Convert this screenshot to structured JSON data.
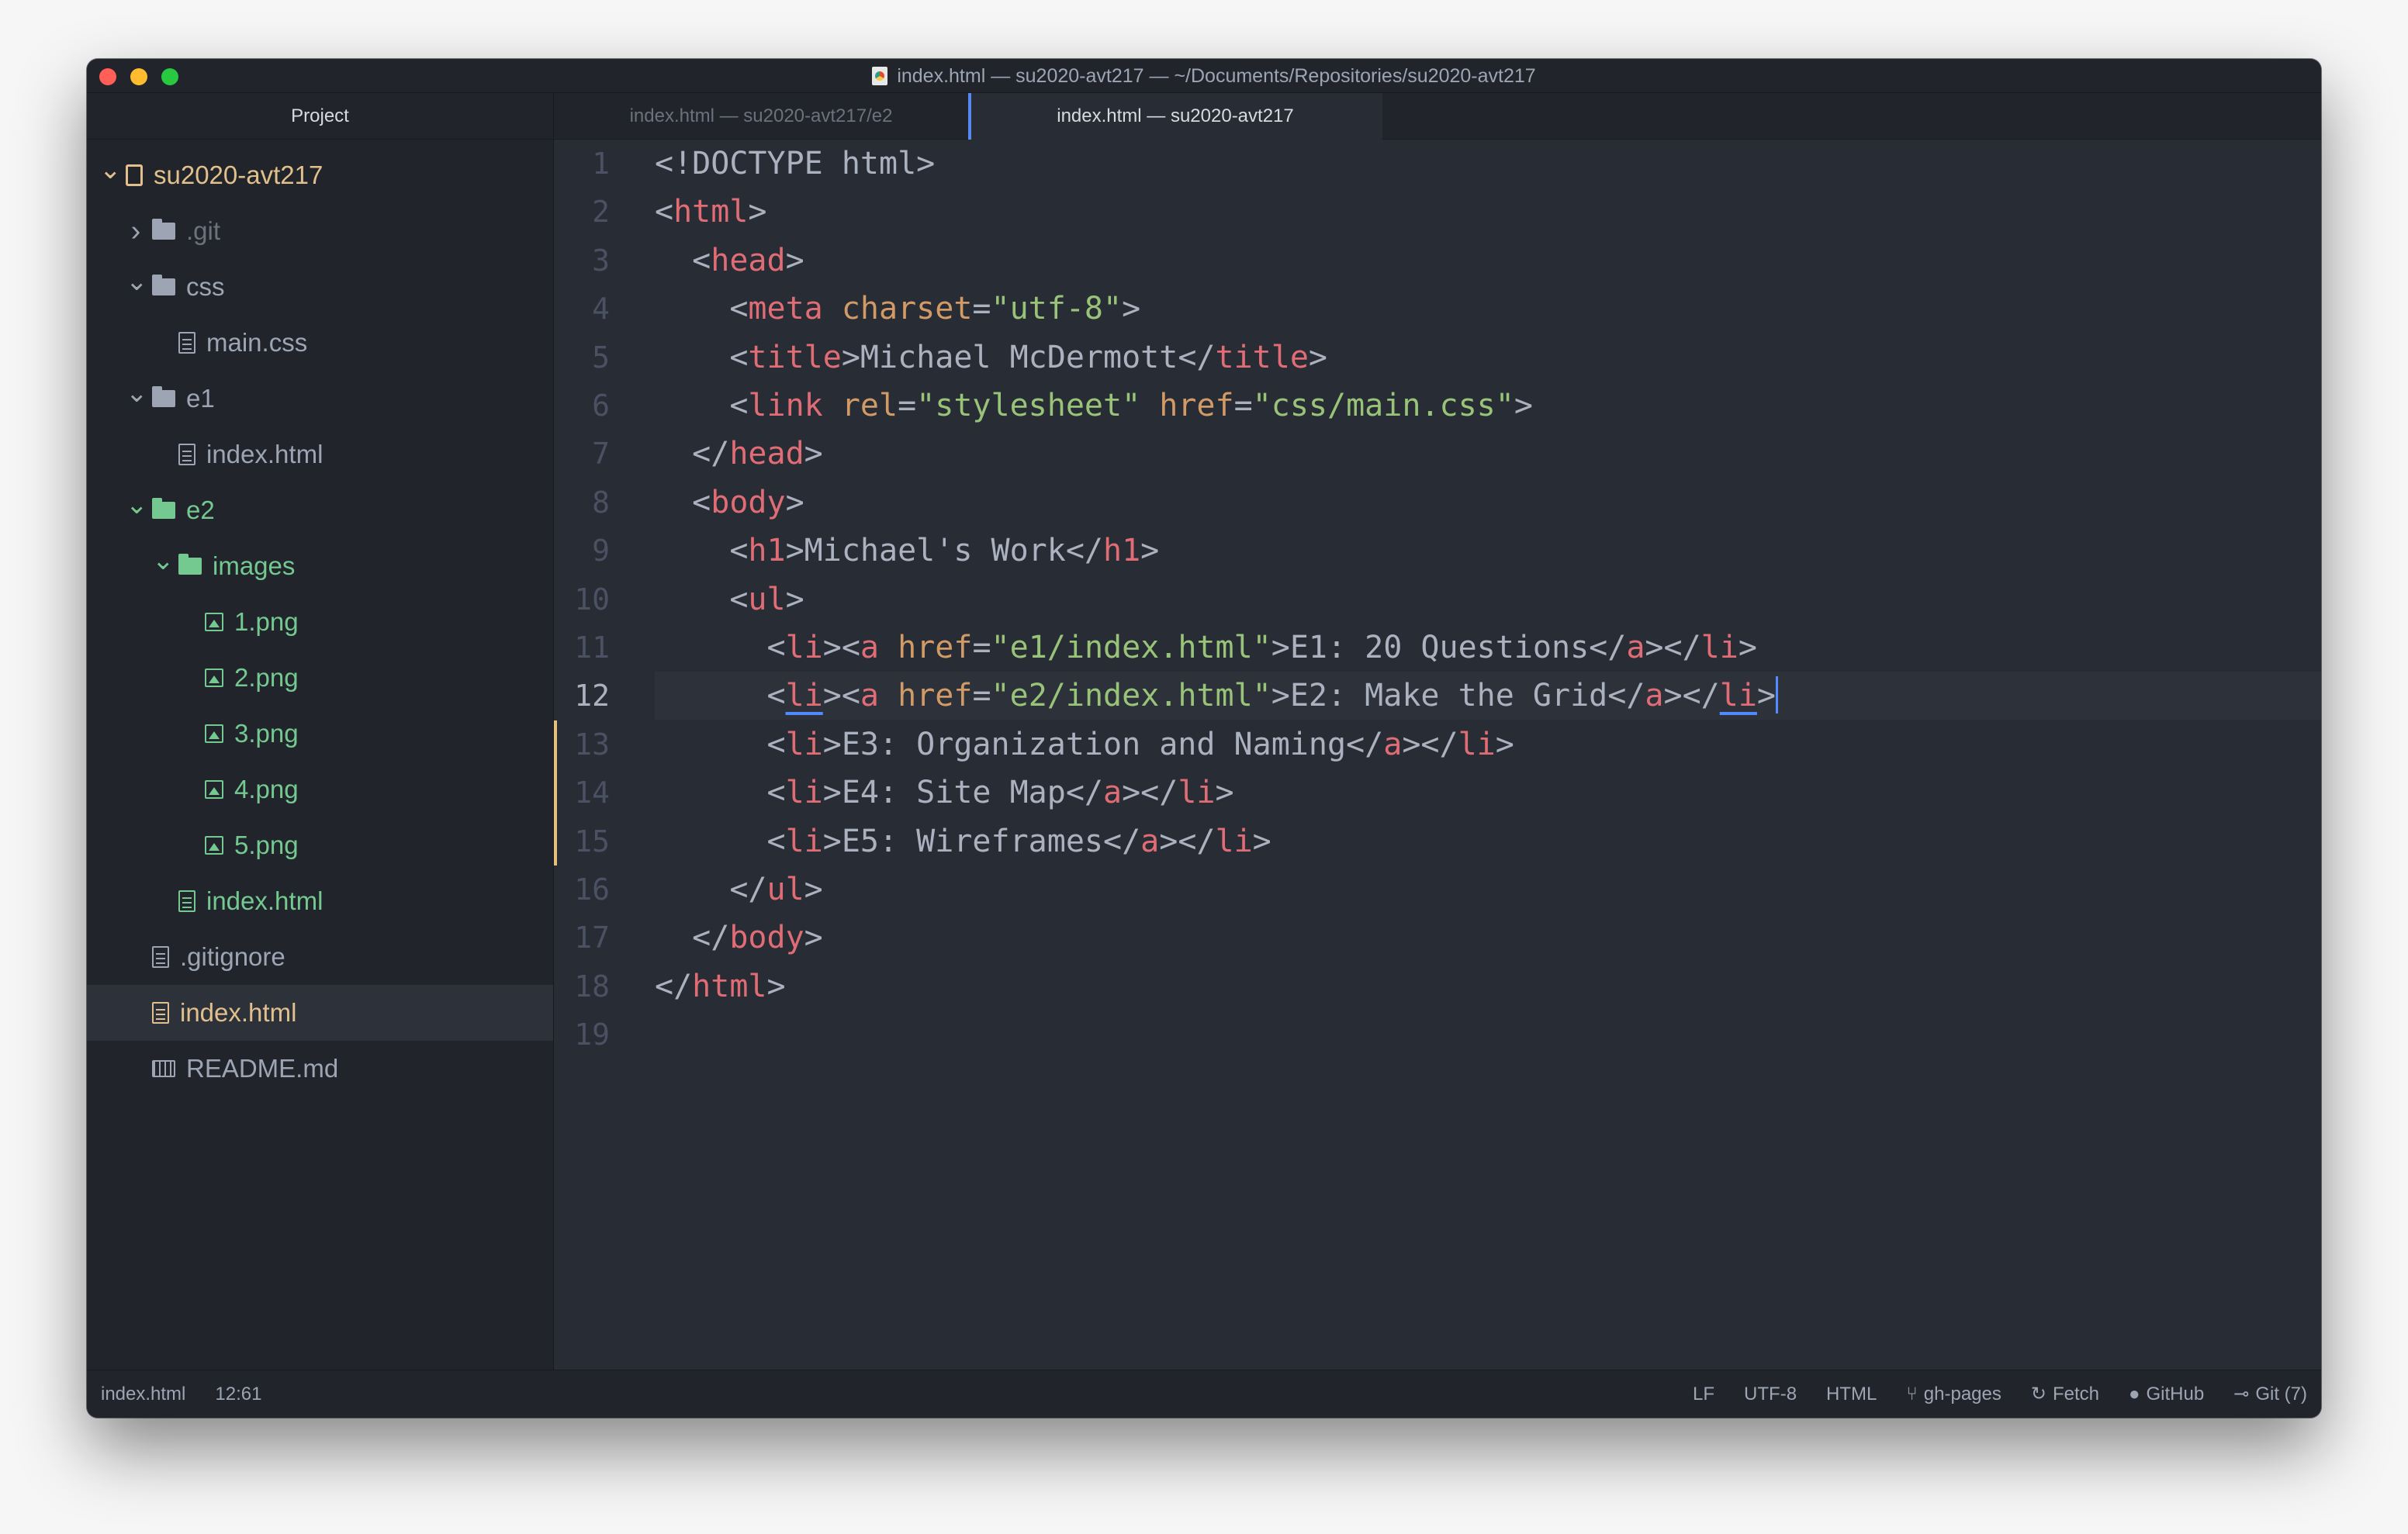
{
  "window": {
    "title": "index.html — su2020-avt217 — ~/Documents/Repositories/su2020-avt217"
  },
  "sidebar": {
    "header": "Project",
    "tree": [
      {
        "name": "root",
        "label": "su2020-avt217",
        "level": 0,
        "chevron": "down",
        "icon": "repo-icon",
        "color": "gold"
      },
      {
        "name": "git-folder",
        "label": ".git",
        "level": 1,
        "chevron": "right",
        "icon": "folder-icon",
        "color": "muted"
      },
      {
        "name": "css-folder",
        "label": "css",
        "level": 1,
        "chevron": "down",
        "icon": "folder-icon",
        "color": "normal"
      },
      {
        "name": "main-css",
        "label": "main.css",
        "level": 2,
        "chevron": "none",
        "icon": "file-icon",
        "color": "normal"
      },
      {
        "name": "e1-folder",
        "label": "e1",
        "level": 1,
        "chevron": "down",
        "icon": "folder-icon",
        "color": "normal"
      },
      {
        "name": "e1-index",
        "label": "index.html",
        "level": 2,
        "chevron": "none",
        "icon": "file-icon",
        "color": "normal"
      },
      {
        "name": "e2-folder",
        "label": "e2",
        "level": 1,
        "chevron": "down",
        "icon": "folder-icon",
        "color": "green"
      },
      {
        "name": "images-folder",
        "label": "images",
        "level": 2,
        "chevron": "down",
        "icon": "folder-icon",
        "color": "green"
      },
      {
        "name": "img-1",
        "label": "1.png",
        "level": 3,
        "chevron": "none",
        "icon": "image-icon",
        "color": "green"
      },
      {
        "name": "img-2",
        "label": "2.png",
        "level": 3,
        "chevron": "none",
        "icon": "image-icon",
        "color": "green"
      },
      {
        "name": "img-3",
        "label": "3.png",
        "level": 3,
        "chevron": "none",
        "icon": "image-icon",
        "color": "green"
      },
      {
        "name": "img-4",
        "label": "4.png",
        "level": 3,
        "chevron": "none",
        "icon": "image-icon",
        "color": "green"
      },
      {
        "name": "img-5",
        "label": "5.png",
        "level": 3,
        "chevron": "none",
        "icon": "image-icon",
        "color": "green"
      },
      {
        "name": "e2-index",
        "label": "index.html",
        "level": 2,
        "chevron": "none",
        "icon": "file-icon",
        "color": "green"
      },
      {
        "name": "gitignore",
        "label": ".gitignore",
        "level": 1,
        "chevron": "none",
        "icon": "file-icon",
        "color": "normal"
      },
      {
        "name": "root-index",
        "label": "index.html",
        "level": 1,
        "chevron": "none",
        "icon": "file-icon",
        "color": "gold",
        "selected": true
      },
      {
        "name": "readme",
        "label": "README.md",
        "level": 1,
        "chevron": "none",
        "icon": "book-icon",
        "color": "normal"
      }
    ]
  },
  "tabs": [
    {
      "label": "index.html — su2020-avt217/e2",
      "active": false
    },
    {
      "label": "index.html — su2020-avt217",
      "active": true
    }
  ],
  "editor": {
    "current_line": 12,
    "modified_lines": [
      13,
      14,
      15
    ],
    "lines": [
      [
        [
          "p",
          "<!DOCTYPE html>"
        ]
      ],
      [
        [
          "p",
          "<"
        ],
        [
          "t",
          "html"
        ],
        [
          "p",
          ">"
        ]
      ],
      [
        [
          "p",
          "  <"
        ],
        [
          "t",
          "head"
        ],
        [
          "p",
          ">"
        ]
      ],
      [
        [
          "p",
          "    <"
        ],
        [
          "t",
          "meta"
        ],
        [
          "p",
          " "
        ],
        [
          "a",
          "charset"
        ],
        [
          "p",
          "="
        ],
        [
          "s",
          "\"utf-8\""
        ],
        [
          "p",
          ">"
        ]
      ],
      [
        [
          "p",
          "    <"
        ],
        [
          "t",
          "title"
        ],
        [
          "p",
          ">Michael McDermott</"
        ],
        [
          "t",
          "title"
        ],
        [
          "p",
          ">"
        ]
      ],
      [
        [
          "p",
          "    <"
        ],
        [
          "t",
          "link"
        ],
        [
          "p",
          " "
        ],
        [
          "a",
          "rel"
        ],
        [
          "p",
          "="
        ],
        [
          "s",
          "\"stylesheet\""
        ],
        [
          "p",
          " "
        ],
        [
          "a",
          "href"
        ],
        [
          "p",
          "="
        ],
        [
          "s",
          "\"css/main.css\""
        ],
        [
          "p",
          ">"
        ]
      ],
      [
        [
          "p",
          "  </"
        ],
        [
          "t",
          "head"
        ],
        [
          "p",
          ">"
        ]
      ],
      [
        [
          "p",
          "  <"
        ],
        [
          "t",
          "body"
        ],
        [
          "p",
          ">"
        ]
      ],
      [
        [
          "p",
          "    <"
        ],
        [
          "t",
          "h1"
        ],
        [
          "p",
          ">Michael's Work</"
        ],
        [
          "t",
          "h1"
        ],
        [
          "p",
          ">"
        ]
      ],
      [
        [
          "p",
          "    <"
        ],
        [
          "t",
          "ul"
        ],
        [
          "p",
          ">"
        ]
      ],
      [
        [
          "p",
          "      <"
        ],
        [
          "t",
          "li"
        ],
        [
          "p",
          "><"
        ],
        [
          "t",
          "a"
        ],
        [
          "p",
          " "
        ],
        [
          "a",
          "href"
        ],
        [
          "p",
          "="
        ],
        [
          "s",
          "\"e1/index.html\""
        ],
        [
          "p",
          ">E1: 20 Questions</"
        ],
        [
          "t",
          "a"
        ],
        [
          "p",
          "></"
        ],
        [
          "t",
          "li"
        ],
        [
          "p",
          ">"
        ]
      ],
      [
        [
          "p",
          "      <"
        ],
        [
          "tu",
          "li"
        ],
        [
          "p",
          "><"
        ],
        [
          "t",
          "a"
        ],
        [
          "p",
          " "
        ],
        [
          "a",
          "href"
        ],
        [
          "p",
          "="
        ],
        [
          "s",
          "\"e2/index.html\""
        ],
        [
          "p",
          ">E2: Make the Grid</"
        ],
        [
          "t",
          "a"
        ],
        [
          "p",
          "></"
        ],
        [
          "tu",
          "li"
        ],
        [
          "p",
          ">"
        ]
      ],
      [
        [
          "p",
          "      <"
        ],
        [
          "t",
          "li"
        ],
        [
          "p",
          ">E3: Organization and Naming</"
        ],
        [
          "t",
          "a"
        ],
        [
          "p",
          "></"
        ],
        [
          "t",
          "li"
        ],
        [
          "p",
          ">"
        ]
      ],
      [
        [
          "p",
          "      <"
        ],
        [
          "t",
          "li"
        ],
        [
          "p",
          ">E4: Site Map</"
        ],
        [
          "t",
          "a"
        ],
        [
          "p",
          "></"
        ],
        [
          "t",
          "li"
        ],
        [
          "p",
          ">"
        ]
      ],
      [
        [
          "p",
          "      <"
        ],
        [
          "t",
          "li"
        ],
        [
          "p",
          ">E5: Wireframes</"
        ],
        [
          "t",
          "a"
        ],
        [
          "p",
          "></"
        ],
        [
          "t",
          "li"
        ],
        [
          "p",
          ">"
        ]
      ],
      [
        [
          "p",
          "    </"
        ],
        [
          "t",
          "ul"
        ],
        [
          "p",
          ">"
        ]
      ],
      [
        [
          "p",
          "  </"
        ],
        [
          "t",
          "body"
        ],
        [
          "p",
          ">"
        ]
      ],
      [
        [
          "p",
          "</"
        ],
        [
          "t",
          "html"
        ],
        [
          "p",
          ">"
        ]
      ],
      [
        [
          "p",
          ""
        ]
      ]
    ]
  },
  "statusbar": {
    "file": "index.html",
    "cursor_pos": "12:61",
    "line_ending": "LF",
    "encoding": "UTF-8",
    "grammar": "HTML",
    "branch": "gh-pages",
    "fetch": "Fetch",
    "github": "GitHub",
    "git": "Git (7)"
  }
}
